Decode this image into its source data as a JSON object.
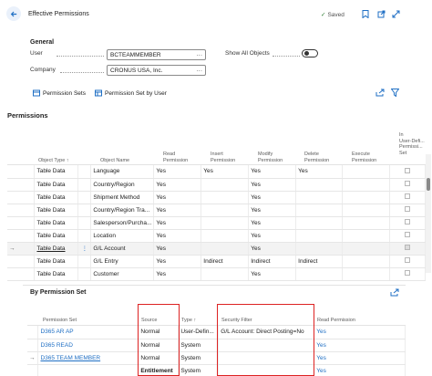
{
  "header": {
    "title": "Effective Permissions",
    "saved_label": "Saved",
    "accent": "#1f6fc4"
  },
  "general": {
    "label": "General",
    "user_label": "User",
    "user_value": "BCTEAMMEMBER",
    "company_label": "Company",
    "company_value": "CRONUS USA, Inc.",
    "show_all_label": "Show All Objects",
    "show_all_value": false,
    "more": "···"
  },
  "actions": {
    "permission_sets": "Permission Sets",
    "permission_set_by_user": "Permission Set by User"
  },
  "permissions": {
    "title": "Permissions",
    "columns": {
      "object_type": "Object Type ↑",
      "object_name": "Object Name",
      "read": [
        "Read",
        "Permission"
      ],
      "insert": [
        "Insert",
        "Permission"
      ],
      "modify": [
        "Modify",
        "Permission"
      ],
      "delete": [
        "Delete",
        "Permission"
      ],
      "execute": [
        "Execute",
        "Permission"
      ],
      "indirect": [
        "In",
        "User-Defi...",
        "Permissi...",
        "Set"
      ]
    },
    "rows": [
      {
        "type": "Table Data",
        "name": "Language",
        "read": "Yes",
        "insert": "Yes",
        "modify": "Yes",
        "delete": "Yes",
        "execute": "",
        "checked": false
      },
      {
        "type": "Table Data",
        "name": "Country/Region",
        "read": "Yes",
        "insert": "",
        "modify": "Yes",
        "delete": "",
        "execute": "",
        "checked": false
      },
      {
        "type": "Table Data",
        "name": "Shipment Method",
        "read": "Yes",
        "insert": "",
        "modify": "Yes",
        "delete": "",
        "execute": "",
        "checked": false
      },
      {
        "type": "Table Data",
        "name": "Country/Region Tra...",
        "read": "Yes",
        "insert": "",
        "modify": "Yes",
        "delete": "",
        "execute": "",
        "checked": false
      },
      {
        "type": "Table Data",
        "name": "Salesperson/Purcha...",
        "read": "Yes",
        "insert": "",
        "modify": "Yes",
        "delete": "",
        "execute": "",
        "checked": false
      },
      {
        "type": "Table Data",
        "name": "Location",
        "read": "Yes",
        "insert": "",
        "modify": "Yes",
        "delete": "",
        "execute": "",
        "checked": false
      },
      {
        "type": "Table Data",
        "name": "G/L Account",
        "read": "Yes",
        "insert": "",
        "modify": "Yes",
        "delete": "",
        "execute": "",
        "checked": true
      },
      {
        "type": "Table Data",
        "name": "G/L Entry",
        "read": "Yes",
        "insert": "Indirect",
        "modify": "Indirect",
        "delete": "Indirect",
        "execute": "",
        "checked": false
      },
      {
        "type": "Table Data",
        "name": "Customer",
        "read": "Yes",
        "insert": "",
        "modify": "Yes",
        "delete": "",
        "execute": "",
        "checked": false
      }
    ]
  },
  "by_set": {
    "title": "By Permission Set",
    "columns": {
      "set": "Permission Set",
      "source": "Source",
      "type": "Type ↑",
      "filter": "Security Filter",
      "read": "Read Permission"
    },
    "rows": [
      {
        "set": "D365 AR AP",
        "source": "Normal",
        "type": "User-Defin...",
        "filter": "G/L Account: Direct Posting=No",
        "read": "Yes",
        "bold": false,
        "underline": false
      },
      {
        "set": "D365 READ",
        "source": "Normal",
        "type": "System",
        "filter": "",
        "read": "Yes",
        "bold": false,
        "underline": false
      },
      {
        "set": "D365 TEAM MEMBER",
        "source": "Normal",
        "type": "System",
        "filter": "",
        "read": "Yes",
        "bold": false,
        "underline": true
      },
      {
        "set": "",
        "source": "Entitlement",
        "type": "System",
        "filter": "",
        "read": "Yes",
        "bold": true,
        "underline": false
      }
    ],
    "highlight_color": "#d22222"
  }
}
